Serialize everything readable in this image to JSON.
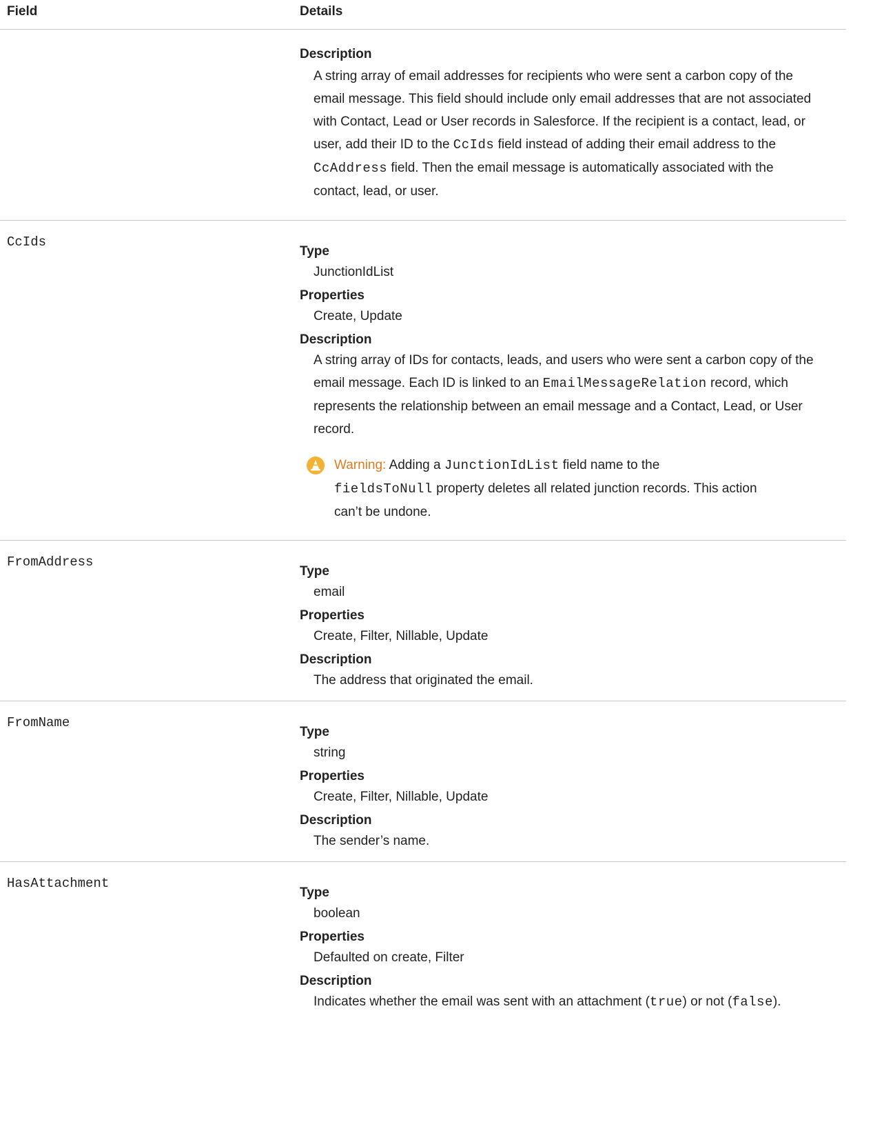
{
  "header": {
    "field": "Field",
    "details": "Details"
  },
  "rows": {
    "ccaddress": {
      "description_label": "Description",
      "d1": "A string array of email addresses for recipients who were sent a carbon copy of the",
      "d2": "email message. This field should include only email addresses that are not associated",
      "d3": "with Contact, Lead or User records in Salesforce. If the recipient is a contact, lead, or",
      "d4a": "user, add their ID to the ",
      "d4code": "CcIds",
      "d4b": " field instead of adding their email address to the",
      "d5code": "CcAddress",
      "d5b": " field. Then the email message is automatically associated with the",
      "d6": "contact, lead, or user."
    },
    "ccids": {
      "name": "CcIds",
      "type_label": "Type",
      "type": "JunctionIdList",
      "properties_label": "Properties",
      "properties": "Create, Update",
      "description_label": "Description",
      "d1": "A string array of IDs for contacts, leads, and users who were sent a carbon copy of the",
      "d2a": "email message. Each ID is linked to an ",
      "d2code": "EmailMessageRelation",
      "d2b": " record, which",
      "d3": "represents the relationship between an email message and a Contact, Lead, or User",
      "d4": "record.",
      "warning_label": "Warning:",
      "w1a": " Adding a ",
      "w1code": "JunctionIdList",
      "w1b": " field name to the",
      "w2code": "fieldsToNull",
      "w2b": " property deletes all related junction records. This action",
      "w3": "can’t be undone."
    },
    "fromaddress": {
      "name": "FromAddress",
      "type_label": "Type",
      "type": "email",
      "properties_label": "Properties",
      "properties": "Create, Filter, Nillable, Update",
      "description_label": "Description",
      "description": "The address that originated the email."
    },
    "fromname": {
      "name": "FromName",
      "type_label": "Type",
      "type": "string",
      "properties_label": "Properties",
      "properties": "Create, Filter, Nillable, Update",
      "description_label": "Description",
      "description": "The sender’s name."
    },
    "hasattachment": {
      "name": "HasAttachment",
      "type_label": "Type",
      "type": "boolean",
      "properties_label": "Properties",
      "properties": "Defaulted on create, Filter",
      "description_label": "Description",
      "d1a": "Indicates whether the email was sent with an attachment (",
      "d1code1": "true",
      "d1b": ") or not (",
      "d1code2": "false",
      "d1c": ")."
    }
  },
  "colors": {
    "warning_accent": "#e07a1f",
    "icon_fill": "#f2b233",
    "divider": "#c9c9c9"
  },
  "icons": {
    "warning": "warning-cone-icon"
  }
}
